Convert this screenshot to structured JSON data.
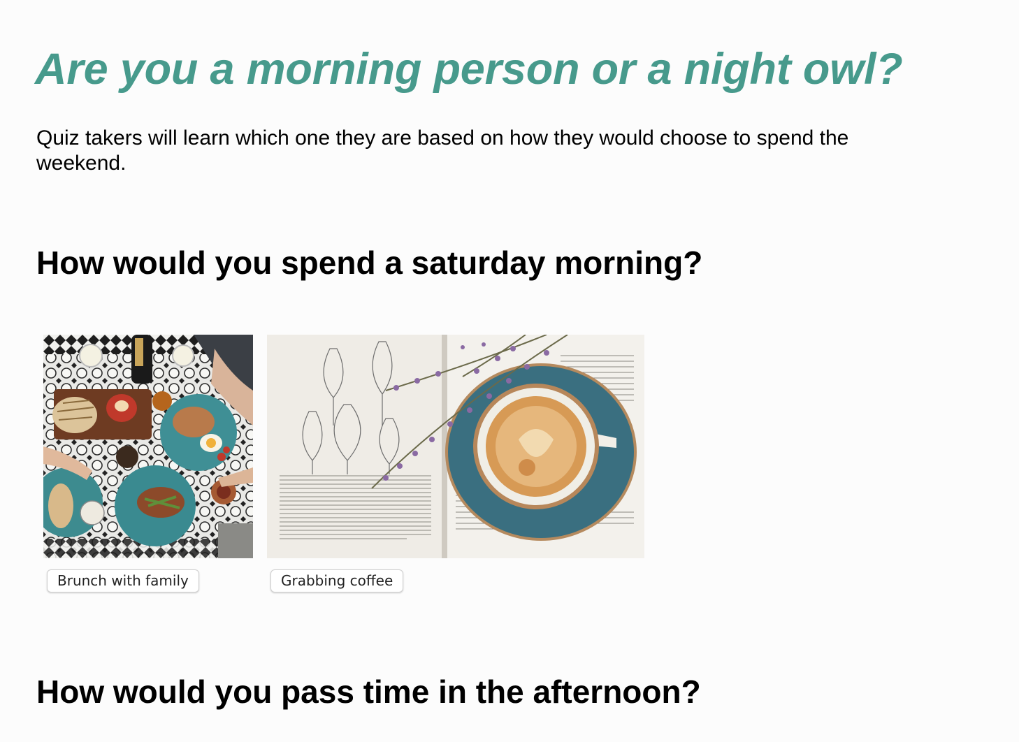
{
  "quiz": {
    "title": "Are you a morning person or a night owl?",
    "description": "Quiz takers will learn which one they are based on how they would choose to spend the weekend."
  },
  "questions": [
    {
      "heading": "How would you spend a saturday morning?",
      "options": [
        {
          "label": "Brunch with family",
          "image": "brunch-table-photo"
        },
        {
          "label": "Grabbing coffee",
          "image": "coffee-on-book-photo"
        }
      ]
    },
    {
      "heading": "How would you pass time in the afternoon?"
    }
  ],
  "colors": {
    "title": "#479a8c",
    "background": "#fcfcfc",
    "text": "#000000"
  }
}
